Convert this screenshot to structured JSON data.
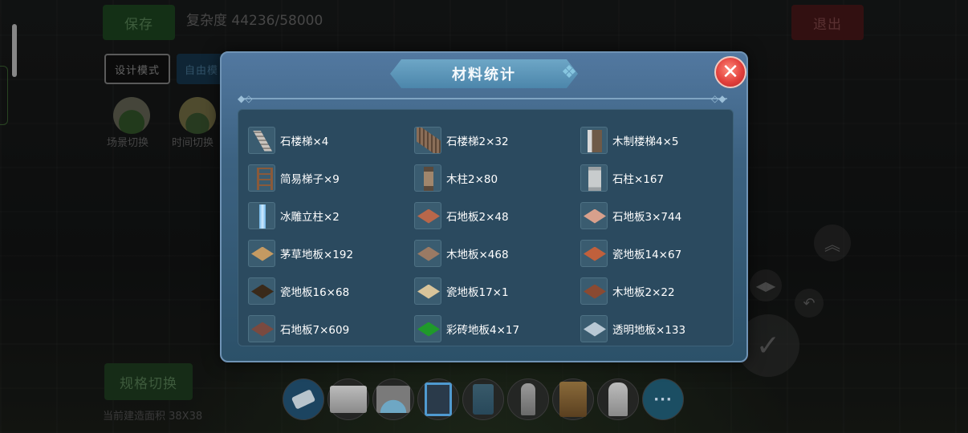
{
  "hud": {
    "save_label": "保存",
    "complexity_text": "复杂度 44236/58000",
    "exit_label": "退出",
    "design_mode_label": "设计模式",
    "free_mode_label": "自由模",
    "scene_switch_label": "场景切换",
    "time_switch_label": "时间切换",
    "spec_switch_label": "规格切换",
    "build_area_text": "当前建造面积 38X38"
  },
  "modal": {
    "title": "材料统计",
    "close_symbol": "✕",
    "items": [
      {
        "label": "石楼梯×4",
        "icon": "stone-stair-icon"
      },
      {
        "label": "石楼梯2×32",
        "icon": "stone-stair-2-icon"
      },
      {
        "label": "木制楼梯4×5",
        "icon": "wood-stair-icon"
      },
      {
        "label": "简易梯子×9",
        "icon": "ladder-icon"
      },
      {
        "label": "木柱2×80",
        "icon": "wood-pillar-icon"
      },
      {
        "label": "石柱×167",
        "icon": "stone-pillar-icon"
      },
      {
        "label": "冰雕立柱×2",
        "icon": "ice-pillar-icon"
      },
      {
        "label": "石地板2×48",
        "icon": "stone-floor-2-icon",
        "color": "#b8674a"
      },
      {
        "label": "石地板3×744",
        "icon": "stone-floor-3-icon",
        "color": "#d8a08c"
      },
      {
        "label": "茅草地板×192",
        "icon": "thatch-floor-icon",
        "color": "#c49a62"
      },
      {
        "label": "木地板×468",
        "icon": "wood-floor-icon",
        "color": "#9a7a64"
      },
      {
        "label": "瓷地板14×67",
        "icon": "tile-floor-14-icon",
        "color": "#c0603c"
      },
      {
        "label": "瓷地板16×68",
        "icon": "tile-floor-16-icon",
        "color": "#3a2a1a"
      },
      {
        "label": "瓷地板17×1",
        "icon": "tile-floor-17-icon",
        "color": "#d8c49a"
      },
      {
        "label": "木地板2×22",
        "icon": "wood-floor-2-icon",
        "color": "#8a4a32"
      },
      {
        "label": "石地板7×609",
        "icon": "stone-floor-7-icon",
        "color": "#7a4a40"
      },
      {
        "label": "彩砖地板4×17",
        "icon": "color-brick-floor-icon",
        "color": "#1f9a2a"
      },
      {
        "label": "透明地板×133",
        "icon": "transparent-floor-icon",
        "color": "#b8c8d4"
      }
    ]
  },
  "toolbar": {
    "more_label": "···"
  }
}
